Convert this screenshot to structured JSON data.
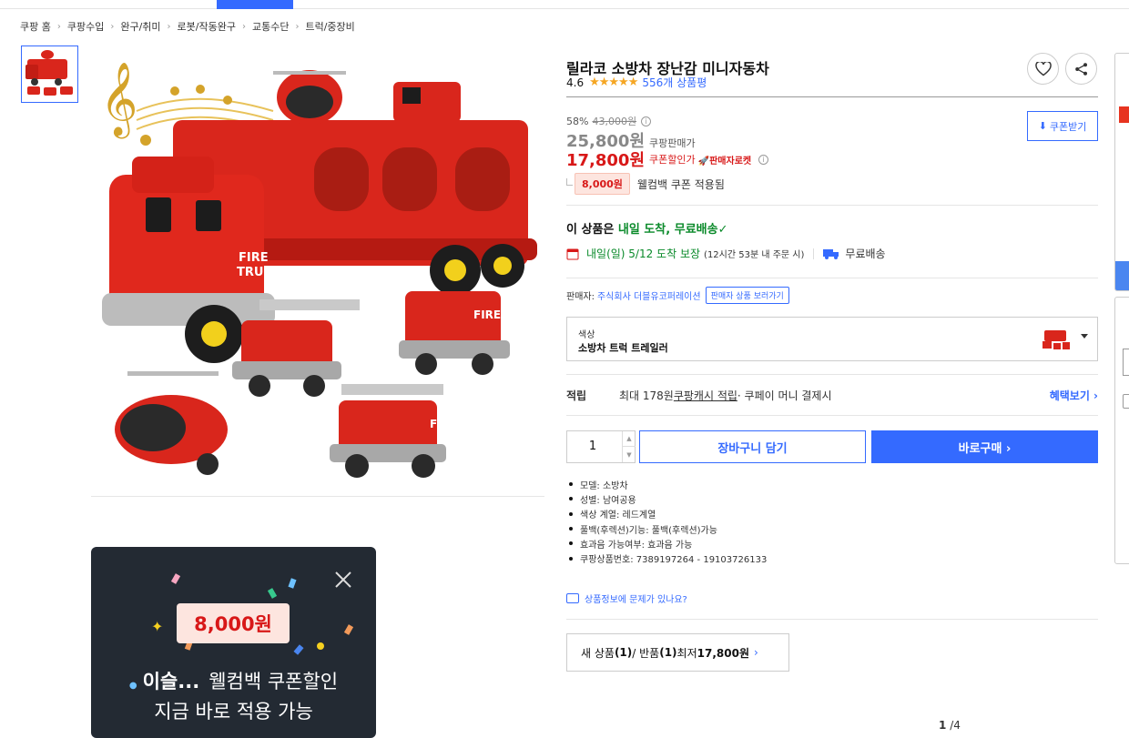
{
  "breadcrumb": [
    "쿠팡 홈",
    "쿠팡수입",
    "완구/취미",
    "로봇/작동완구",
    "교통수단",
    "트럭/중장비"
  ],
  "product": {
    "title": "릴라코 소방차 장난감 미니자동차",
    "rating": "4.6",
    "stars": "★★★★★",
    "review_count": "556개 상품평"
  },
  "price": {
    "discount_rate": "58%",
    "original": "43,000원",
    "coupang_price": "25,800원",
    "coupang_price_label": "쿠팡판매가",
    "coupon_price": "17,800원",
    "coupon_price_label": "쿠폰할인가",
    "rocket_label": "판매자로켓",
    "coupon_amount": "8,000원",
    "coupon_applied": "웰컴백 쿠폰 적용됨",
    "coupon_button": "쿠폰받기"
  },
  "delivery": {
    "headline_prefix": "이 상품은 ",
    "headline_highlight": "내일 도착, 무료배송",
    "check": "✓",
    "date": "내일(일) 5/12 도착 보장",
    "deadline": "(12시간 53분 내 주문 시)",
    "free_shipping": "무료배송"
  },
  "seller": {
    "label": "판매자:",
    "name": "주식회사 더블유코퍼레이션",
    "tooltip": "판매자 상품 보러가기"
  },
  "option": {
    "label": "색상",
    "value": "소방차 트럭 트레일러"
  },
  "reward": {
    "label": "적립",
    "text_prefix": "최대 178원 ",
    "text_link": "쿠팡캐시 적립",
    "text_suffix": " · 쿠페이 머니 결제시",
    "more": "혜택보기 ›"
  },
  "purchase": {
    "quantity": "1",
    "cart_button": "장바구니 담기",
    "buy_button": "바로구매 ›"
  },
  "specs": [
    "모델: 소방차",
    "성별: 남여공용",
    "색상 계열: 레드계열",
    "풀백(후렉션)기능: 풀백(후렉션)가능",
    "효과음 가능여부: 효과음 가능",
    "쿠팡상품번호: 7389197264 - 19103726133"
  ],
  "report_link": "상품정보에 문제가 있나요?",
  "offer": {
    "prefix": "새 상품 ",
    "count1": "(1)",
    "mid": " / 반품 ",
    "count2": "(1)",
    "min_label": " 최저 ",
    "min_price": "17,800원",
    "chevron": "›"
  },
  "pager": {
    "current": "1",
    "total": "/4"
  },
  "popup": {
    "coupon": "8,000원",
    "user": "이슬...",
    "line1": "웰컴백 쿠폰할인",
    "line2": "지금 바로 적용 가능"
  },
  "colors": {
    "accent": "#346aff",
    "sale": "#d81818",
    "delivery": "#0a8a2a",
    "popup_bg": "#232a33"
  }
}
